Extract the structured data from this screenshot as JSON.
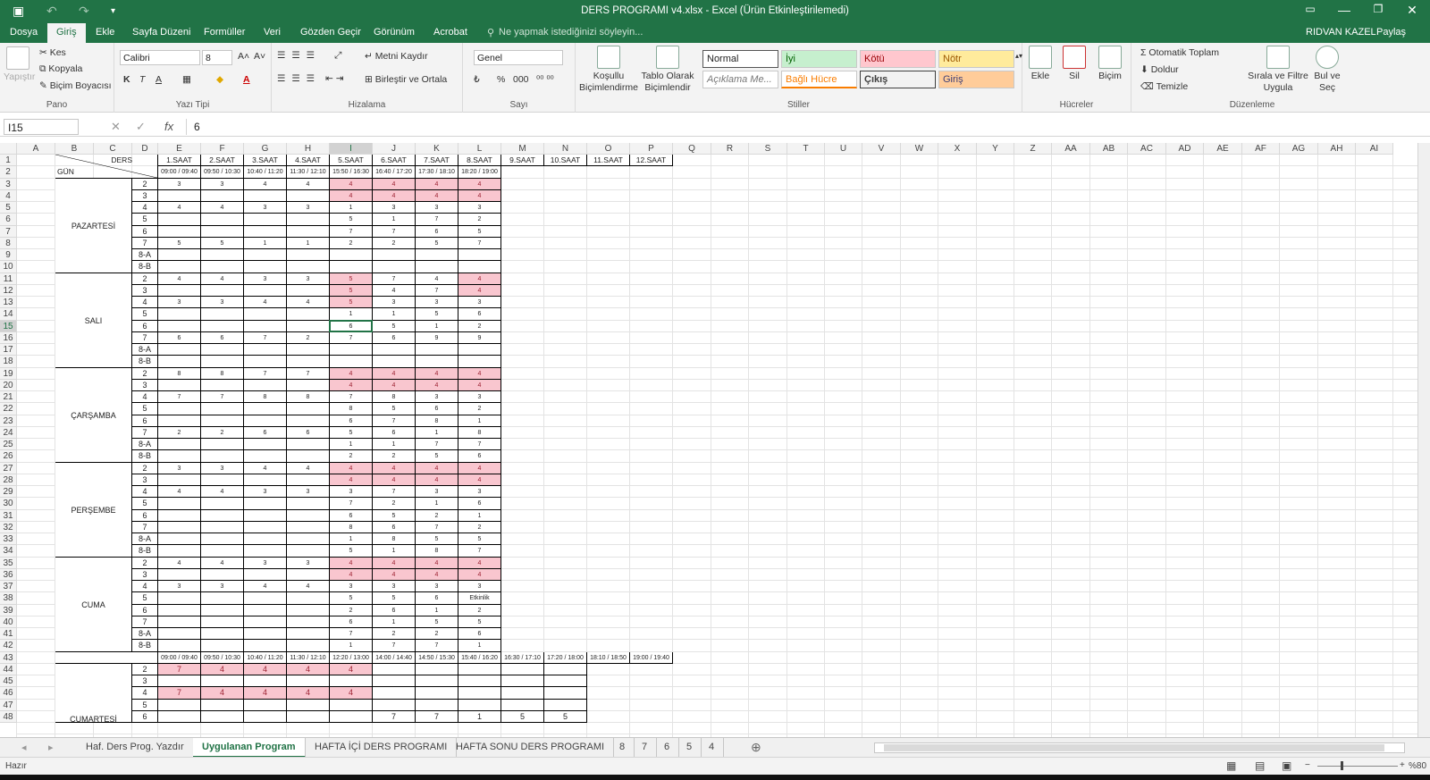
{
  "title": "DERS PROGRAMI v4.xlsx - Excel (Ürün Etkinleştirilemedi)",
  "user": "RIDVAN KAZEL",
  "share": "Paylaş",
  "menu": [
    "Dosya",
    "Giriş",
    "Ekle",
    "Sayfa Düzeni",
    "Formüller",
    "Veri",
    "Gözden Geçir",
    "Görünüm",
    "Acrobat"
  ],
  "tellme": "Ne yapmak istediğinizi söyleyin...",
  "ribbon": {
    "pano": {
      "label": "Pano",
      "paste": "Yapıştır",
      "cut": "Kes",
      "copy": "Kopyala",
      "painter": "Biçim Boyacısı"
    },
    "font": {
      "label": "Yazı Tipi",
      "name": "Calibri",
      "size": "8",
      "bold": "K",
      "italic": "T",
      "underline": "A"
    },
    "align": {
      "label": "Hizalama",
      "wrap": "Metni Kaydır",
      "merge": "Birleştir ve Ortala"
    },
    "number": {
      "label": "Sayı",
      "format": "Genel"
    },
    "styles": {
      "label": "Stiller",
      "cond": "Koşullu Biçimlendirme",
      "table": "Tablo Olarak Biçimlendir",
      "normal": "Normal",
      "iyi": "İyi",
      "kotu": "Kötü",
      "notr": "Nötr",
      "aciklama": "Açıklama Me...",
      "bagli": "Bağlı Hücre",
      "cikis": "Çıkış",
      "giris": "Giriş"
    },
    "cells": {
      "label": "Hücreler",
      "insert": "Ekle",
      "delete": "Sil",
      "format": "Biçim"
    },
    "editing": {
      "label": "Düzenleme",
      "autosum": "Otomatik Toplam",
      "fill": "Doldur",
      "clear": "Temizle",
      "sort": "Sırala ve Filtre Uygula",
      "find": "Bul ve Seç"
    },
    "colors": {
      "iyi": "#c6efce",
      "kotu": "#ffc7ce",
      "notr": "#ffeb9c",
      "giris": "#ffcc99"
    }
  },
  "namebox": "I15",
  "formula": "6",
  "columns": [
    "A",
    "B",
    "C",
    "D",
    "E",
    "F",
    "G",
    "H",
    "I",
    "J",
    "K",
    "L",
    "M",
    "N",
    "O",
    "P",
    "Q",
    "R",
    "S",
    "T",
    "U",
    "V",
    "W",
    "X",
    "Y",
    "Z",
    "AA",
    "AB",
    "AC",
    "AD",
    "AE",
    "AF",
    "AG",
    "AH",
    "AI"
  ],
  "rows": [
    "1",
    "2",
    "3",
    "4",
    "5",
    "6",
    "7",
    "8",
    "9",
    "10",
    "11",
    "12",
    "13",
    "14",
    "15",
    "16",
    "17",
    "18",
    "19",
    "20",
    "21",
    "22",
    "23",
    "24",
    "25",
    "26",
    "27",
    "28",
    "29",
    "30",
    "31",
    "32",
    "33",
    "34",
    "35",
    "36",
    "37",
    "38",
    "39",
    "40",
    "41",
    "42",
    "43",
    "44",
    "45",
    "46",
    "47",
    "48"
  ],
  "corner": {
    "ders": "DERS",
    "gun": "GÜN"
  },
  "saat_headers": [
    "1.SAAT",
    "2.SAAT",
    "3.SAAT",
    "4.SAAT",
    "5.SAAT",
    "6.SAAT",
    "7.SAAT",
    "8.SAAT",
    "9.SAAT",
    "10.SAAT",
    "11.SAAT",
    "12.SAAT"
  ],
  "times_row2": [
    "09:00 / 09:40",
    "09:50 / 10:30",
    "10:40 / 11:20",
    "11:30 / 12:10",
    "15:50 / 16:30",
    "16:40 / 17:20",
    "17:30 / 18:10",
    "18:20 / 19:00"
  ],
  "times_row43": [
    "09:00 / 09:40",
    "09:50 / 10:30",
    "10:40 / 11:20",
    "11:30 / 12:10",
    "12:20 / 13:00",
    "14:00 / 14:40",
    "14:50 / 15:30",
    "15:40 / 16:20",
    "16:30 / 17:10",
    "17:20 / 18:00",
    "18:10 / 18:50",
    "19:00 / 19:40"
  ],
  "classes": [
    "2",
    "3",
    "4",
    "5",
    "6",
    "7",
    "8-A",
    "8-B"
  ],
  "days": [
    {
      "name": "PAZARTESİ",
      "rows": [
        [
          "3",
          "3",
          "4",
          "4",
          "4",
          "4",
          "4",
          "4"
        ],
        [
          "",
          "",
          "",
          "",
          "4",
          "4",
          "4",
          "4"
        ],
        [
          "4",
          "4",
          "3",
          "3",
          "1",
          "3",
          "3",
          "3"
        ],
        [
          "",
          "",
          "",
          "",
          "5",
          "1",
          "7",
          "2"
        ],
        [
          "",
          "",
          "",
          "",
          "7",
          "7",
          "6",
          "5"
        ],
        [
          "5",
          "5",
          "1",
          "1",
          "2",
          "2",
          "5",
          "7"
        ],
        [
          "",
          "",
          "",
          "",
          "",
          "",
          "",
          ""
        ],
        [
          "",
          "",
          "",
          "",
          "",
          "",
          "",
          ""
        ]
      ],
      "pink": [
        [
          0,
          4
        ],
        [
          0,
          5
        ],
        [
          0,
          6
        ],
        [
          0,
          7
        ],
        [
          1,
          4
        ],
        [
          1,
          5
        ],
        [
          1,
          6
        ],
        [
          1,
          7
        ]
      ]
    },
    {
      "name": "SALI",
      "rows": [
        [
          "4",
          "4",
          "3",
          "3",
          "5",
          "7",
          "4",
          "4"
        ],
        [
          "",
          "",
          "",
          "",
          "5",
          "4",
          "7",
          "4"
        ],
        [
          "3",
          "3",
          "4",
          "4",
          "5",
          "3",
          "3",
          "3"
        ],
        [
          "",
          "",
          "",
          "",
          "1",
          "1",
          "5",
          "6"
        ],
        [
          "",
          "",
          "",
          "",
          "6",
          "5",
          "1",
          "2"
        ],
        [
          "6",
          "6",
          "7",
          "2",
          "7",
          "6",
          "9",
          "9"
        ],
        [
          "",
          "",
          "",
          "",
          "",
          "",
          "",
          ""
        ],
        [
          "",
          "",
          "",
          "",
          "",
          "",
          "",
          ""
        ]
      ],
      "pink": [
        [
          0,
          4
        ],
        [
          0,
          7
        ],
        [
          1,
          4
        ],
        [
          1,
          7
        ],
        [
          2,
          4
        ]
      ]
    },
    {
      "name": "ÇARŞAMBA",
      "rows": [
        [
          "8",
          "8",
          "7",
          "7",
          "4",
          "4",
          "4",
          "4"
        ],
        [
          "",
          "",
          "",
          "",
          "4",
          "4",
          "4",
          "4"
        ],
        [
          "7",
          "7",
          "8",
          "8",
          "7",
          "8",
          "3",
          "3"
        ],
        [
          "",
          "",
          "",
          "",
          "8",
          "5",
          "6",
          "2"
        ],
        [
          "",
          "",
          "",
          "",
          "6",
          "7",
          "8",
          "1"
        ],
        [
          "2",
          "2",
          "6",
          "6",
          "5",
          "6",
          "1",
          "8"
        ],
        [
          "",
          "",
          "",
          "",
          "1",
          "1",
          "7",
          "7"
        ],
        [
          "",
          "",
          "",
          "",
          "2",
          "2",
          "5",
          "6"
        ]
      ],
      "pink": [
        [
          0,
          4
        ],
        [
          0,
          5
        ],
        [
          0,
          6
        ],
        [
          0,
          7
        ],
        [
          1,
          4
        ],
        [
          1,
          5
        ],
        [
          1,
          6
        ],
        [
          1,
          7
        ]
      ]
    },
    {
      "name": "PERŞEMBE",
      "rows": [
        [
          "3",
          "3",
          "4",
          "4",
          "4",
          "4",
          "4",
          "4"
        ],
        [
          "",
          "",
          "",
          "",
          "4",
          "4",
          "4",
          "4"
        ],
        [
          "4",
          "4",
          "3",
          "3",
          "3",
          "7",
          "3",
          "3"
        ],
        [
          "",
          "",
          "",
          "",
          "7",
          "2",
          "1",
          "6"
        ],
        [
          "",
          "",
          "",
          "",
          "6",
          "5",
          "2",
          "1"
        ],
        [
          "",
          "",
          "",
          "",
          "8",
          "6",
          "7",
          "2"
        ],
        [
          "",
          "",
          "",
          "",
          "1",
          "8",
          "5",
          "5"
        ],
        [
          "",
          "",
          "",
          "",
          "5",
          "1",
          "8",
          "7"
        ]
      ],
      "pink": [
        [
          0,
          4
        ],
        [
          0,
          5
        ],
        [
          0,
          6
        ],
        [
          0,
          7
        ],
        [
          1,
          4
        ],
        [
          1,
          5
        ],
        [
          1,
          6
        ],
        [
          1,
          7
        ]
      ]
    },
    {
      "name": "CUMA",
      "rows": [
        [
          "4",
          "4",
          "3",
          "3",
          "4",
          "4",
          "4",
          "4"
        ],
        [
          "",
          "",
          "",
          "",
          "4",
          "4",
          "4",
          "4"
        ],
        [
          "3",
          "3",
          "4",
          "4",
          "3",
          "3",
          "3",
          "3"
        ],
        [
          "",
          "",
          "",
          "",
          "5",
          "5",
          "6",
          "Etkinlik"
        ],
        [
          "",
          "",
          "",
          "",
          "2",
          "6",
          "1",
          "2"
        ],
        [
          "",
          "",
          "",
          "",
          "6",
          "1",
          "5",
          "5"
        ],
        [
          "",
          "",
          "",
          "",
          "7",
          "2",
          "2",
          "6"
        ],
        [
          "",
          "",
          "",
          "",
          "1",
          "7",
          "7",
          "1"
        ]
      ],
      "pink": [
        [
          0,
          4
        ],
        [
          0,
          5
        ],
        [
          0,
          6
        ],
        [
          0,
          7
        ],
        [
          1,
          4
        ],
        [
          1,
          5
        ],
        [
          1,
          6
        ],
        [
          1,
          7
        ]
      ]
    }
  ],
  "weekend": {
    "name": "CUMARTESİ",
    "rows": [
      [
        "7",
        "4",
        "4",
        "4",
        "4",
        "",
        "",
        "",
        "",
        ""
      ],
      [
        "",
        "",
        "",
        "",
        "",
        "",
        "",
        "",
        "",
        ""
      ],
      [
        "7",
        "4",
        "4",
        "4",
        "4",
        "",
        "",
        "",
        "",
        ""
      ],
      [
        "",
        "",
        "",
        "",
        "",
        "",
        "",
        "",
        "",
        ""
      ],
      [
        "",
        "",
        "",
        "",
        "",
        "7",
        "7",
        "1",
        "5",
        "5"
      ]
    ],
    "classes": [
      "2",
      "3",
      "4",
      "5",
      "6"
    ]
  },
  "tabs": [
    "Haf. Ders Prog. Yazdır",
    "Uygulanan Program",
    "HAFTA İÇİ DERS PROGRAMI",
    "HAFTA SONU DERS PROGRAMI",
    "8",
    "7",
    "6",
    "5",
    "4"
  ],
  "active_tab": "Uygulanan Program",
  "status": "Hazır",
  "zoom": "%80"
}
